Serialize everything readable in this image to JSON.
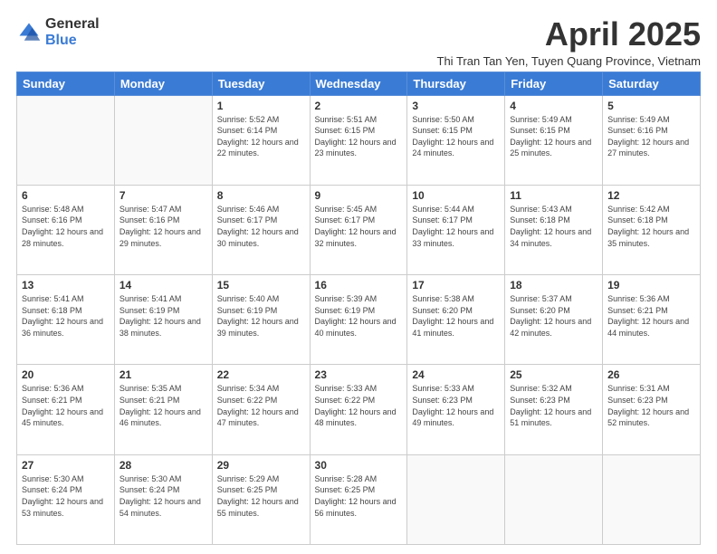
{
  "header": {
    "logo_general": "General",
    "logo_blue": "Blue",
    "month_title": "April 2025",
    "subtitle": "Thi Tran Tan Yen, Tuyen Quang Province, Vietnam"
  },
  "weekdays": [
    "Sunday",
    "Monday",
    "Tuesday",
    "Wednesday",
    "Thursday",
    "Friday",
    "Saturday"
  ],
  "weeks": [
    [
      {
        "day": "",
        "info": ""
      },
      {
        "day": "",
        "info": ""
      },
      {
        "day": "1",
        "info": "Sunrise: 5:52 AM\nSunset: 6:14 PM\nDaylight: 12 hours and 22 minutes."
      },
      {
        "day": "2",
        "info": "Sunrise: 5:51 AM\nSunset: 6:15 PM\nDaylight: 12 hours and 23 minutes."
      },
      {
        "day": "3",
        "info": "Sunrise: 5:50 AM\nSunset: 6:15 PM\nDaylight: 12 hours and 24 minutes."
      },
      {
        "day": "4",
        "info": "Sunrise: 5:49 AM\nSunset: 6:15 PM\nDaylight: 12 hours and 25 minutes."
      },
      {
        "day": "5",
        "info": "Sunrise: 5:49 AM\nSunset: 6:16 PM\nDaylight: 12 hours and 27 minutes."
      }
    ],
    [
      {
        "day": "6",
        "info": "Sunrise: 5:48 AM\nSunset: 6:16 PM\nDaylight: 12 hours and 28 minutes."
      },
      {
        "day": "7",
        "info": "Sunrise: 5:47 AM\nSunset: 6:16 PM\nDaylight: 12 hours and 29 minutes."
      },
      {
        "day": "8",
        "info": "Sunrise: 5:46 AM\nSunset: 6:17 PM\nDaylight: 12 hours and 30 minutes."
      },
      {
        "day": "9",
        "info": "Sunrise: 5:45 AM\nSunset: 6:17 PM\nDaylight: 12 hours and 32 minutes."
      },
      {
        "day": "10",
        "info": "Sunrise: 5:44 AM\nSunset: 6:17 PM\nDaylight: 12 hours and 33 minutes."
      },
      {
        "day": "11",
        "info": "Sunrise: 5:43 AM\nSunset: 6:18 PM\nDaylight: 12 hours and 34 minutes."
      },
      {
        "day": "12",
        "info": "Sunrise: 5:42 AM\nSunset: 6:18 PM\nDaylight: 12 hours and 35 minutes."
      }
    ],
    [
      {
        "day": "13",
        "info": "Sunrise: 5:41 AM\nSunset: 6:18 PM\nDaylight: 12 hours and 36 minutes."
      },
      {
        "day": "14",
        "info": "Sunrise: 5:41 AM\nSunset: 6:19 PM\nDaylight: 12 hours and 38 minutes."
      },
      {
        "day": "15",
        "info": "Sunrise: 5:40 AM\nSunset: 6:19 PM\nDaylight: 12 hours and 39 minutes."
      },
      {
        "day": "16",
        "info": "Sunrise: 5:39 AM\nSunset: 6:19 PM\nDaylight: 12 hours and 40 minutes."
      },
      {
        "day": "17",
        "info": "Sunrise: 5:38 AM\nSunset: 6:20 PM\nDaylight: 12 hours and 41 minutes."
      },
      {
        "day": "18",
        "info": "Sunrise: 5:37 AM\nSunset: 6:20 PM\nDaylight: 12 hours and 42 minutes."
      },
      {
        "day": "19",
        "info": "Sunrise: 5:36 AM\nSunset: 6:21 PM\nDaylight: 12 hours and 44 minutes."
      }
    ],
    [
      {
        "day": "20",
        "info": "Sunrise: 5:36 AM\nSunset: 6:21 PM\nDaylight: 12 hours and 45 minutes."
      },
      {
        "day": "21",
        "info": "Sunrise: 5:35 AM\nSunset: 6:21 PM\nDaylight: 12 hours and 46 minutes."
      },
      {
        "day": "22",
        "info": "Sunrise: 5:34 AM\nSunset: 6:22 PM\nDaylight: 12 hours and 47 minutes."
      },
      {
        "day": "23",
        "info": "Sunrise: 5:33 AM\nSunset: 6:22 PM\nDaylight: 12 hours and 48 minutes."
      },
      {
        "day": "24",
        "info": "Sunrise: 5:33 AM\nSunset: 6:23 PM\nDaylight: 12 hours and 49 minutes."
      },
      {
        "day": "25",
        "info": "Sunrise: 5:32 AM\nSunset: 6:23 PM\nDaylight: 12 hours and 51 minutes."
      },
      {
        "day": "26",
        "info": "Sunrise: 5:31 AM\nSunset: 6:23 PM\nDaylight: 12 hours and 52 minutes."
      }
    ],
    [
      {
        "day": "27",
        "info": "Sunrise: 5:30 AM\nSunset: 6:24 PM\nDaylight: 12 hours and 53 minutes."
      },
      {
        "day": "28",
        "info": "Sunrise: 5:30 AM\nSunset: 6:24 PM\nDaylight: 12 hours and 54 minutes."
      },
      {
        "day": "29",
        "info": "Sunrise: 5:29 AM\nSunset: 6:25 PM\nDaylight: 12 hours and 55 minutes."
      },
      {
        "day": "30",
        "info": "Sunrise: 5:28 AM\nSunset: 6:25 PM\nDaylight: 12 hours and 56 minutes."
      },
      {
        "day": "",
        "info": ""
      },
      {
        "day": "",
        "info": ""
      },
      {
        "day": "",
        "info": ""
      }
    ]
  ]
}
